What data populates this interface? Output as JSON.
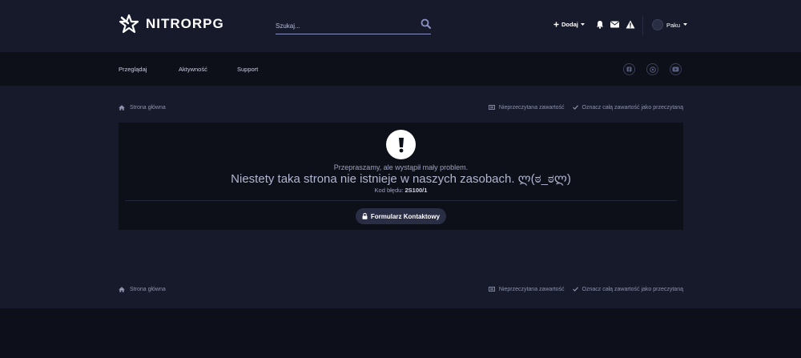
{
  "header": {
    "logo_text": "NITRORPG",
    "search_placeholder": "Szukaj...",
    "add_label": "Dodaj",
    "username": "Paku",
    "icons": [
      "search-icon",
      "plus-icon",
      "bell-icon",
      "envelope-icon",
      "warning-icon",
      "chevron-down-icon"
    ]
  },
  "nav": {
    "items": [
      {
        "label": "Przeglądaj"
      },
      {
        "label": "Aktywność"
      },
      {
        "label": "Support"
      }
    ],
    "social_icons": [
      "facebook-icon",
      "discord-icon",
      "youtube-icon"
    ]
  },
  "breadcrumb": {
    "home_label": "Strona główna",
    "unread_label": "Nieprzeczytana zawartość",
    "mark_read_label": "Oznacz całą zawartość jako przeczytaną"
  },
  "error": {
    "subtitle": "Przepraszamy, ale wystąpił mały problem.",
    "message": "Niestety taka strona nie istnieje w naszych zasobach. ლ(ಠ_ಠლ)",
    "code_label": "Kod błędu:",
    "code_value": "2S100/1",
    "contact_button": "Formularz Kontaktowy"
  },
  "colors": {
    "header_bg": "#171a2b",
    "nav_bg": "#0e1019",
    "content_bg": "#171a2b",
    "box_bg": "#0e1019",
    "button_bg": "#2a2e44",
    "accent": "#8a93c4"
  }
}
